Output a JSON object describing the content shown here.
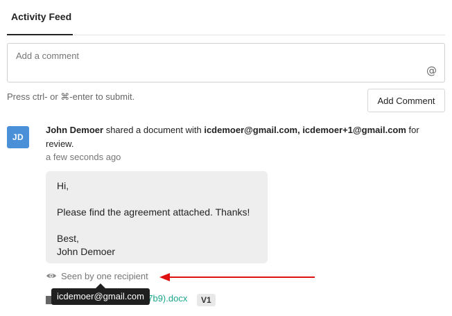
{
  "tabs": {
    "active_label": "Activity Feed"
  },
  "comment": {
    "placeholder": "Add a comment",
    "mention_icon": "@",
    "hint": "Press ctrl- or ⌘-enter to submit.",
    "submit_label": "Add Comment"
  },
  "feed": {
    "avatar_initials": "JD",
    "actor": "John Demoer",
    "action_text": " shared a document with ",
    "recipients": "icdemoer@gmail.com, icdemoer+1@gmail.com",
    "trailing_text": " for review.",
    "timestamp": "a few seconds ago",
    "message": {
      "line1": "Hi,",
      "line2": "Please find the agreement attached. Thanks!",
      "line3": "Best,",
      "line4": "John Demoer"
    },
    "seen_text": "Seen by one recipient",
    "tooltip": "icdemoer@gmail.com",
    "file_name_visible": "57b9).docx",
    "file_version": "V1"
  },
  "colors": {
    "avatar_bg": "#4a90d9",
    "link": "#1aa58b",
    "arrow": "#e01010",
    "tooltip_bg": "#1f1f1f"
  }
}
